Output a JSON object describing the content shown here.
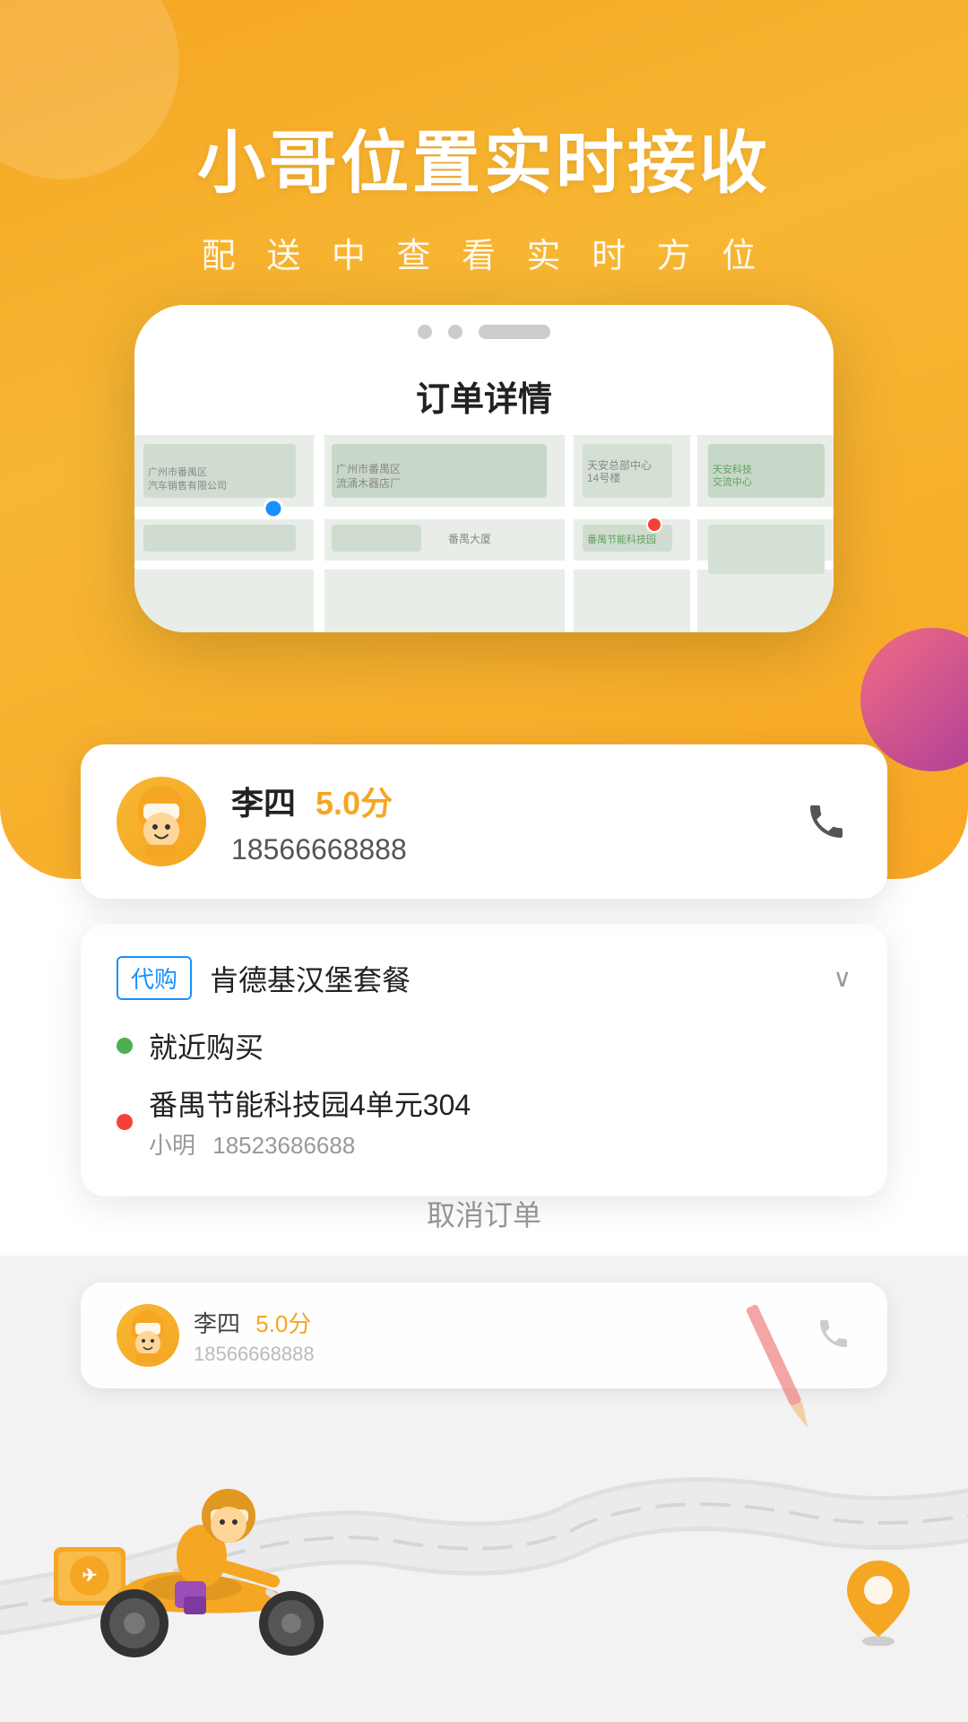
{
  "hero": {
    "title": "小哥位置实时接收",
    "subtitle": "配 送 中 查 看 实 时 方 位"
  },
  "phone": {
    "order_header": "订单详情"
  },
  "driver": {
    "name": "李四",
    "rating": "5.0分",
    "phone": "18566668888"
  },
  "order": {
    "tag": "代购",
    "name": "肯德基汉堡套餐",
    "pickup_label": "就近购买",
    "delivery_address": "番禺节能科技园4单元304",
    "contact_name": "小明",
    "contact_phone": "18523686688"
  },
  "actions": {
    "cancel_label": "取消订单"
  },
  "bottom_card": {
    "driver_name": "李四",
    "driver_rating": "5.0分"
  },
  "icons": {
    "call": "📞",
    "chevron_down": "∨",
    "location_pin": "📍"
  }
}
